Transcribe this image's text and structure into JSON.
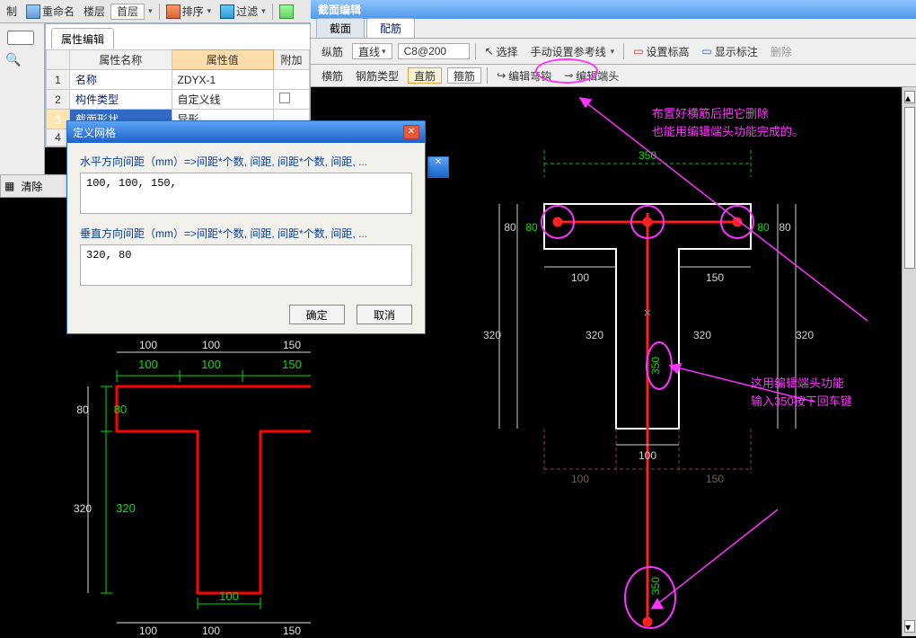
{
  "top_toolbar": {
    "copy_ctrl": "复制",
    "rename": "重命名",
    "floor_label": "楼层",
    "floor_value": "首层",
    "sort": "排序",
    "filter": "过滤",
    "clear": "清除"
  },
  "prop_panel": {
    "tab": "属性编辑",
    "col_name": "属性名称",
    "col_value": "属性值",
    "col_extra": "附加",
    "rows": [
      {
        "idx": "1",
        "name": "名称",
        "value": "ZDYX-1"
      },
      {
        "idx": "2",
        "name": "构件类型",
        "value": "自定义线"
      },
      {
        "idx": "3",
        "name": "截面形状",
        "value": "异形"
      },
      {
        "idx": "4",
        "name": "",
        "value": ""
      }
    ]
  },
  "mini_toolbar": {
    "clear": "清除"
  },
  "dialog": {
    "title": "定义网格",
    "h_label": "水平方向间距（mm）=>间距*个数, 间距, 间距*个数, 间距, ...",
    "h_value": "100, 100, 150,",
    "v_label": "垂直方向间距（mm）=>间距*个数, 间距, 间距*个数, 间距, ...",
    "v_value": "320, 80",
    "ok": "确定",
    "cancel": "取消"
  },
  "editor": {
    "title": "截面编辑",
    "tabs": {
      "section": "截面",
      "rebar": "配筋"
    },
    "row1": {
      "main_label": "纵筋",
      "main_type": "直线",
      "main_spec": "C8@200",
      "select": "选择",
      "manual_ref": "手动设置参考线",
      "set_elev": "设置标高",
      "show_label": "显示标注",
      "delete": "删除"
    },
    "row2": {
      "trans": "横筋",
      "rebar_type_label": "钢筋类型",
      "straight": "直筋",
      "stirrup": "箍筋",
      "edit_hook": "编辑弯钩",
      "edit_end": "编辑端头"
    }
  },
  "annotations": {
    "top": "布置好横筋后把它删除\n也能用编辑端头功能完成的。",
    "mid": "这用编辑端头功能\n输入350按下回车键"
  },
  "dims_left": {
    "top": [
      "100",
      "100",
      "150"
    ],
    "side_left_top": "80",
    "side_right_top": "80",
    "lg_left": "320",
    "lg_right": "320",
    "bot_mid": "100",
    "bot_outer": [
      "100",
      "100",
      "150"
    ],
    "inner_left": "80",
    "inner_right": "80",
    "inner_lg_l": "320",
    "inner_lg_r": "320"
  },
  "dims_right": {
    "top_total": "350",
    "side_top_l": "80",
    "side_top_r": "80",
    "under_top_l": "100",
    "under_top_r": "150",
    "mid_l": "320",
    "mid_r": "320",
    "mid_side_l": "320",
    "mid_side_r": "320",
    "green_350": "350",
    "bot_mid": "100",
    "bot_ghost_l": "100",
    "bot_ghost_r": "150",
    "green_350b": "350"
  }
}
